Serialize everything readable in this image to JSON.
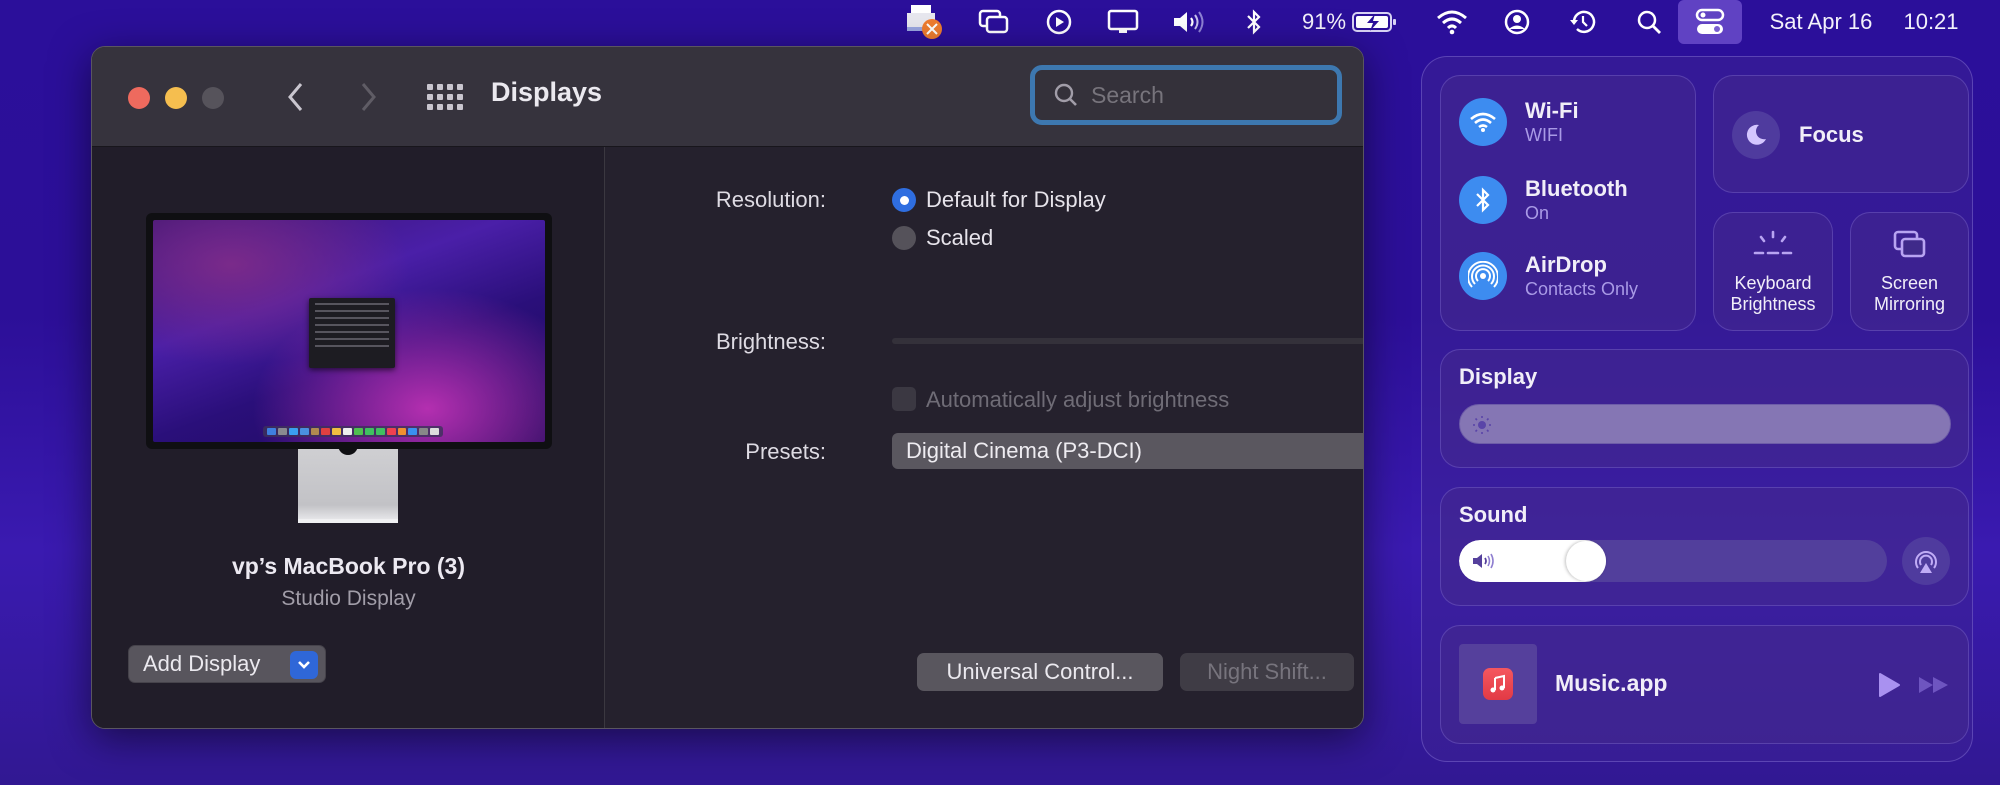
{
  "menubar": {
    "battery_percent": "91%",
    "date": "Sat Apr 16",
    "time": "10:21",
    "icons": [
      "printer-error-icon",
      "screen-mirroring-icon",
      "play-icon",
      "display-icon",
      "volume-icon",
      "bluetooth-icon",
      "battery-charging-icon",
      "wifi-icon",
      "user-icon",
      "time-machine-icon",
      "spotlight-search-icon",
      "control-center-icon"
    ]
  },
  "window": {
    "title": "Displays",
    "search": {
      "placeholder": "Search",
      "value": ""
    },
    "sidebar": {
      "device_name": "vp’s MacBook Pro (3)",
      "device_model": "Studio Display",
      "add_display_label": "Add Display"
    },
    "settings": {
      "resolution_label": "Resolution:",
      "resolution_options": [
        {
          "label": "Default for Display",
          "selected": true
        },
        {
          "label": "Scaled",
          "selected": false
        }
      ],
      "brightness_label": "Brightness:",
      "brightness_value": 1.0,
      "auto_brightness_label": "Automatically adjust brightness",
      "auto_brightness_checked": false,
      "presets_label": "Presets:",
      "presets_value": "Digital Cinema (P3-DCI)"
    },
    "buttons": {
      "universal_control": "Universal Control...",
      "night_shift": "Night Shift...",
      "help": "?"
    }
  },
  "control_center": {
    "wifi": {
      "title": "Wi-Fi",
      "subtitle": "WIFI"
    },
    "bluetooth": {
      "title": "Bluetooth",
      "subtitle": "On"
    },
    "airdrop": {
      "title": "AirDrop",
      "subtitle": "Contacts Only"
    },
    "focus": {
      "title": "Focus"
    },
    "keyboard_brightness": {
      "line1": "Keyboard",
      "line2": "Brightness"
    },
    "screen_mirroring": {
      "line1": "Screen",
      "line2": "Mirroring"
    },
    "display": {
      "title": "Display",
      "brightness_value": 1.0
    },
    "sound": {
      "title": "Sound",
      "volume_value": 0.25
    },
    "now_playing": {
      "app": "Music.app"
    }
  },
  "colors": {
    "accent_blue": "#2f6ee0",
    "cc_icon_blue": "#3d8cf0",
    "search_focus_ring": "#3d78b0",
    "close": "#ee6a5e",
    "minimize": "#f5be4f"
  }
}
